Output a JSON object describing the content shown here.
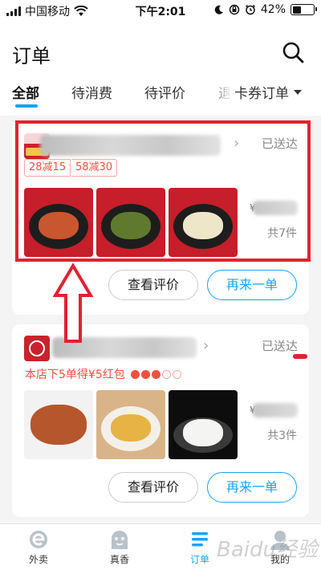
{
  "status_bar": {
    "carrier": "中国移动",
    "time": "下午2:01",
    "battery": "42%",
    "battery_level": 0.42
  },
  "header": {
    "title": "订单",
    "search_icon": "search-icon"
  },
  "tabs": {
    "items": [
      "全部",
      "待消费",
      "待评价"
    ],
    "cut_item": "退",
    "dropdown_label": "卡券订单",
    "active_index": 0
  },
  "orders": [
    {
      "status": "已送达",
      "promos": [
        "28减15",
        "58减30"
      ],
      "price_symbol": "¥",
      "count": "共7件",
      "buttons": {
        "review": "查看评价",
        "reorder": "再来一单"
      }
    },
    {
      "status": "已送达",
      "promo_text": "本店下5单得¥5红包",
      "progress_checked": 3,
      "progress_total": 5,
      "price_symbol": "¥",
      "count": "共3件",
      "buttons": {
        "review": "查看评价",
        "reorder": "再来一单"
      }
    }
  ],
  "bottom_nav": {
    "items": [
      {
        "label": "外卖",
        "icon": "takeout-icon"
      },
      {
        "label": "真香",
        "icon": "zhenxiang-icon"
      },
      {
        "label": "订单",
        "icon": "order-list-icon"
      },
      {
        "label": "我的",
        "icon": "profile-icon"
      }
    ],
    "active_index": 2
  },
  "watermark": "Baidu经验",
  "colors": {
    "accent": "#1aa3f0",
    "promo_red": "#f0503e",
    "annotation_red": "#e02232"
  }
}
